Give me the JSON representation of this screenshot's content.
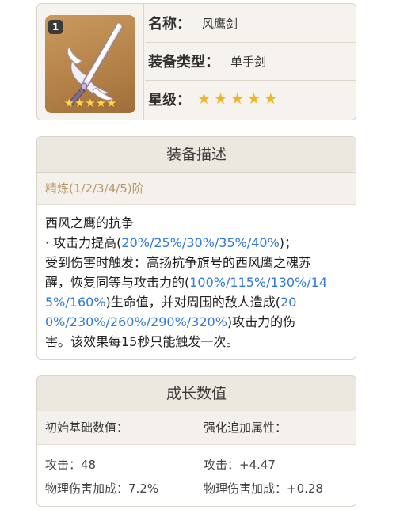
{
  "weapon": {
    "rank_badge": "1",
    "name_label": "名称：",
    "name_value": "风鹰剑",
    "type_label": "装备类型：",
    "type_value": "单手剑",
    "rarity_label": "星级：",
    "rarity_stars": 5,
    "icon_stars": "★★★★★",
    "star_char": "★",
    "star_color": "#f2b422"
  },
  "description": {
    "title": "装备描述",
    "refinement": "精炼(1/2/3/4/5)阶",
    "lines": [
      [
        {
          "t": "西风之鹰的抗争",
          "c": ""
        }
      ],
      [
        {
          "t": "· 攻击力提高(",
          "c": ""
        },
        {
          "t": "20%/25%/30%/35%/40%",
          "c": "blue"
        },
        {
          "t": ")；",
          "c": ""
        }
      ],
      [
        {
          "t": "受到伤害时触发：高扬抗争旗号的西风鹰之魂苏",
          "c": ""
        }
      ],
      [
        {
          "t": "醒，恢复同等与攻击力的(",
          "c": ""
        },
        {
          "t": "100%/115%/130%/14",
          "c": "blue"
        }
      ],
      [
        {
          "t": "5%/160%",
          "c": "blue"
        },
        {
          "t": ")生命值，并对周围的敌人造成(",
          "c": ""
        },
        {
          "t": "20",
          "c": "blue"
        }
      ],
      [
        {
          "t": "0%/230%/260%/290%/320%",
          "c": "blue"
        },
        {
          "t": ")攻击力的伤",
          "c": ""
        }
      ],
      [
        {
          "t": "害。该效果每15秒只能触发一次。",
          "c": ""
        }
      ]
    ],
    "highlight_color": "#2f79d8"
  },
  "growth": {
    "title": "成长数值",
    "base_header": "初始基础数值：",
    "bonus_header": "强化追加属性：",
    "base": [
      "攻击：48",
      "物理伤害加成：7.2%"
    ],
    "bonus": [
      "攻击：+4.47",
      "物理伤害加成：+0.28"
    ]
  }
}
